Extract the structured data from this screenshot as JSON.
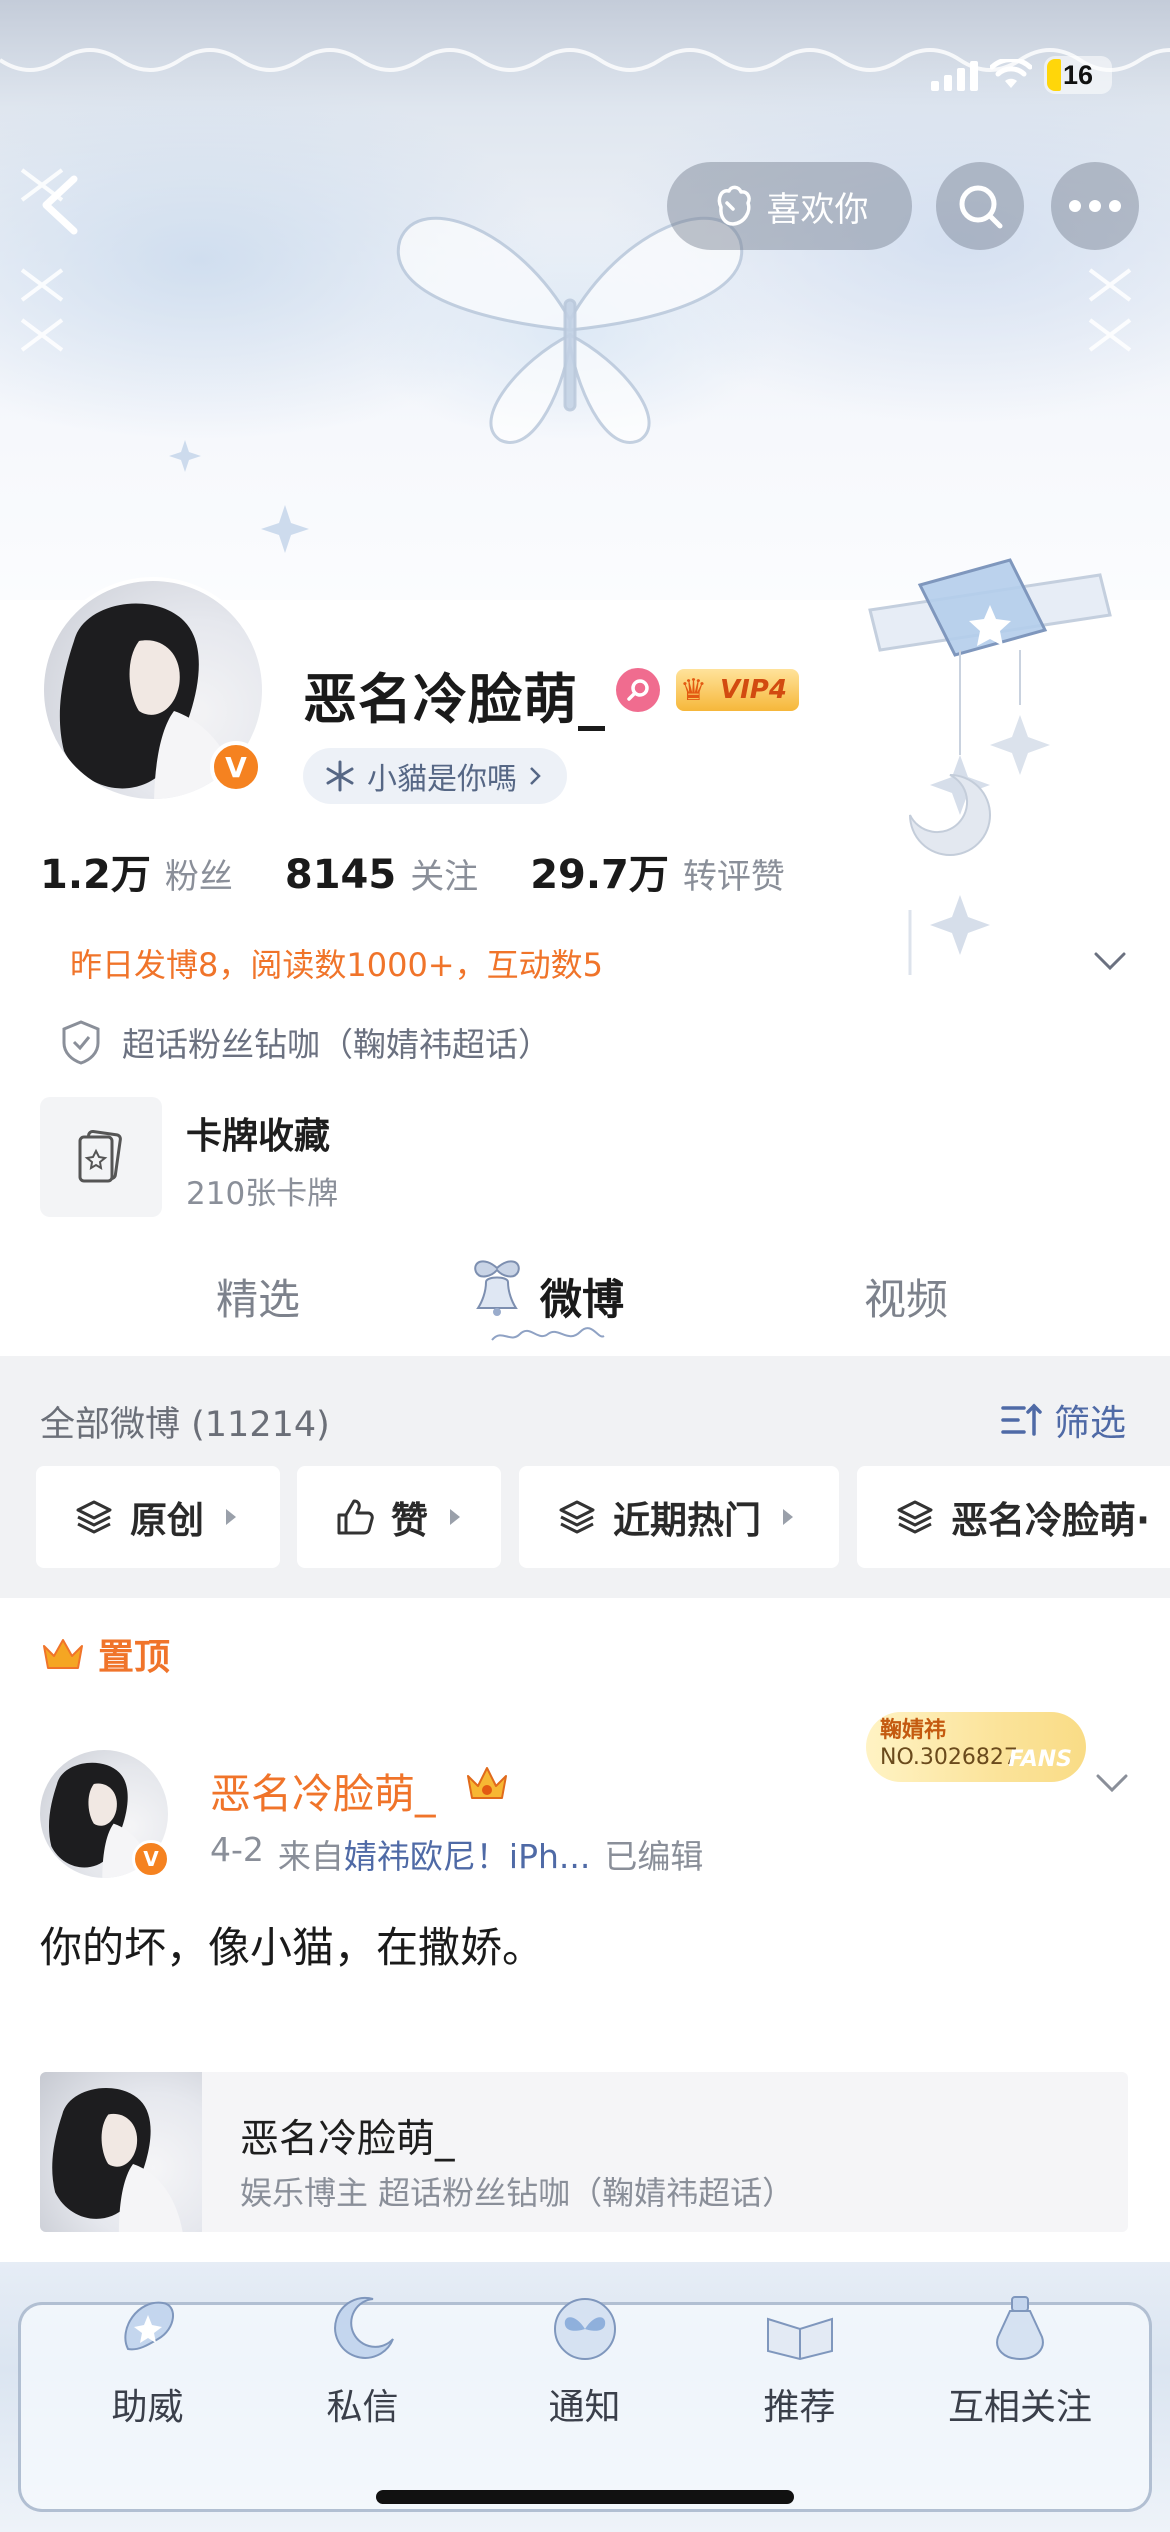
{
  "status_bar": {
    "battery": "16"
  },
  "header": {
    "back_icon": "chevron-left-icon",
    "like_label": "喜欢你",
    "search_icon": "search-icon",
    "more_icon": "more-icon"
  },
  "profile": {
    "name": "恶名冷脸萌_",
    "vip": "VIP4",
    "signature": "小貓是你嗎",
    "stats": [
      {
        "num": "1.2万",
        "label": "粉丝"
      },
      {
        "num": "8145",
        "label": "关注"
      },
      {
        "num": "29.7万",
        "label": "转评赞"
      }
    ],
    "yesterday": "昨日发博8，阅读数1000+，互动数5",
    "supertopic": "超话粉丝钻咖（鞠婧祎超话）",
    "card_title": "卡牌收藏",
    "card_count": "210张卡牌"
  },
  "tabs": [
    {
      "label": "精选",
      "active": false
    },
    {
      "label": "微博",
      "active": true
    },
    {
      "label": "视频",
      "active": false
    }
  ],
  "filter": {
    "all_posts": "全部微博 (11214)",
    "filter_label": "筛选",
    "chips": [
      "原创",
      "赞",
      "近期热门",
      "恶名冷脸萌·"
    ]
  },
  "post": {
    "pinned_label": "置顶",
    "author": "恶名冷脸萌_",
    "date": "4-2",
    "from_prefix": "来自",
    "source": "婧祎欧尼！iPh...",
    "edited": "已编辑",
    "fans_badge_name": "鞠婧祎",
    "fans_badge_no": "NO.3026827",
    "fans_badge_word": "FANS",
    "text": "你的坏，像小猫，在撒娇。",
    "quote_name": "恶名冷脸萌_",
    "quote_sub": "娱乐博主 超话粉丝钻咖（鞠婧祎超话）"
  },
  "bottom_nav": [
    "助威",
    "私信",
    "通知",
    "推荐",
    "互相关注"
  ],
  "colors": {
    "accent_orange": "#f0742a",
    "link_blue": "#4f6aa6",
    "verified_orange": "#f58220"
  }
}
